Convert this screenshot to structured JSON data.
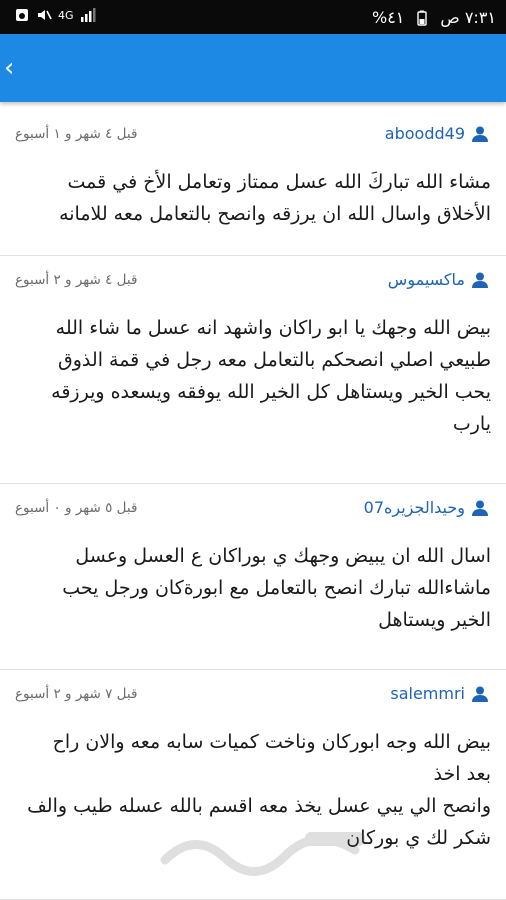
{
  "status": {
    "time": "٧:٣١ ص",
    "battery": "%٤١",
    "network": "4G"
  },
  "posts": [
    {
      "user": "aboodd49",
      "time": "قبل ٤ شهر و ١ أسبوع",
      "text": "مشاء الله تباركَ الله عسل ممتاز وتعامل الأخ في قمت\nالأخلاق واسال الله ان يرزقه وانصح بالتعامل معه للامانه"
    },
    {
      "user": "ماكسيموس",
      "time": "قبل ٤ شهر و ٢ أسبوع",
      "text": "بيض الله وجهك يا ابو راكان واشهد انه عسل ما شاء الله\nطبيعي اصلي انصحكم بالتعامل معه رجل في قمة الذوق\nيحب الخير ويستاهل كل الخير الله يوفقه ويسعده ويرزقه\nيارب"
    },
    {
      "user": "وحيدالجزيره07",
      "time": "قبل ٥ شهر و ٠ أسبوع",
      "text": "اسال الله ان يبيض وجهك ي بوراكان ع العسل وعسل\nماشاءالله  تبارك  انصح بالتعامل مع ابورةكان ورجل يحب\nالخير ويستاهل"
    },
    {
      "user": "salemmri",
      "time": "قبل ٧ شهر و ٢ أسبوع",
      "text": "بيض الله وجه ابوركان وناخت كميات سابه معه والان راح\nبعد اخذ\nوانصح الي يبي عسل يخذ معه اقسم بالله عسله طيب والف\nشكر لك ي بوركان"
    }
  ],
  "icons": {
    "user": "user-icon",
    "back": "chevron-left-icon"
  },
  "colors": {
    "appbar": "#1e88e5",
    "username": "#1e64b4"
  }
}
